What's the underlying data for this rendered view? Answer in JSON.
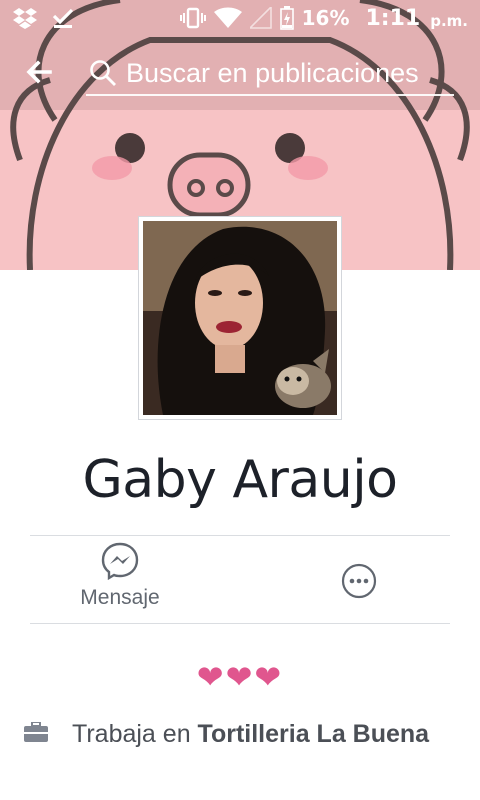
{
  "status_bar": {
    "battery_percent": "16%",
    "time": "1:11",
    "ampm": "p.m.",
    "left_icons": [
      "dropbox-icon",
      "download-done-icon"
    ],
    "right_icons": [
      "vibrate-icon",
      "wifi-icon",
      "signal-icon",
      "battery-icon"
    ]
  },
  "header": {
    "search_placeholder": "Buscar en publicaciones"
  },
  "profile": {
    "name": "Gaby Araujo"
  },
  "actions": {
    "message_label": "Mensaje"
  },
  "bio": {
    "hearts": "❤❤❤"
  },
  "work": {
    "prefix": "Trabaja en ",
    "company": "Tortilleria La Buena"
  },
  "colors": {
    "cover_bg": "#f7c3c5",
    "heart": "#e0568e",
    "icon_gray": "#616770",
    "text_dark": "#1d2129"
  }
}
